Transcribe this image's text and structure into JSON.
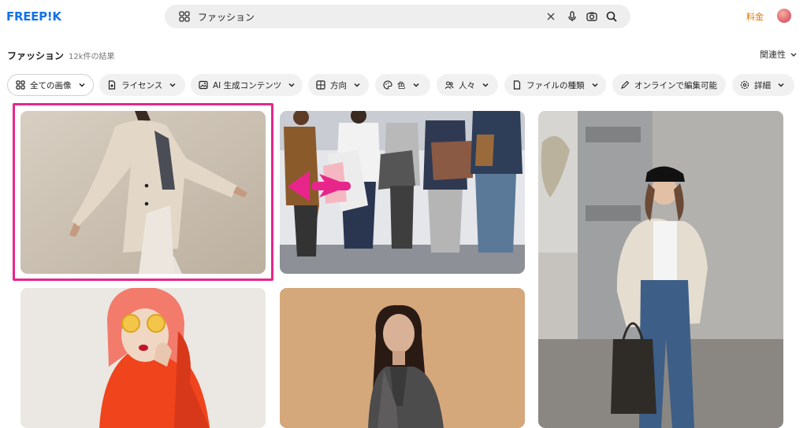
{
  "header": {
    "logo": "FREEP!K",
    "search_value": "ファッション",
    "pricing_label": "料金"
  },
  "title_row": {
    "title": "ファッション",
    "results": "12k件の結果",
    "sort_label": "関連性"
  },
  "filters": [
    {
      "label": "全ての画像",
      "icon": "grid-icon"
    },
    {
      "label": "ライセンス",
      "icon": "license-icon"
    },
    {
      "label": "AI 生成コンテンツ",
      "icon": "ai-image-icon"
    },
    {
      "label": "方向",
      "icon": "orientation-icon"
    },
    {
      "label": "色",
      "icon": "palette-icon"
    },
    {
      "label": "人々",
      "icon": "people-icon"
    },
    {
      "label": "ファイルの種類",
      "icon": "file-icon"
    },
    {
      "label": "オンラインで編集可能",
      "icon": "pen-icon"
    },
    {
      "label": "詳細",
      "icon": "settings-icon"
    }
  ],
  "colors": {
    "brand": "#1273eb",
    "highlight": "#e8258a",
    "pricing": "#e37500"
  }
}
